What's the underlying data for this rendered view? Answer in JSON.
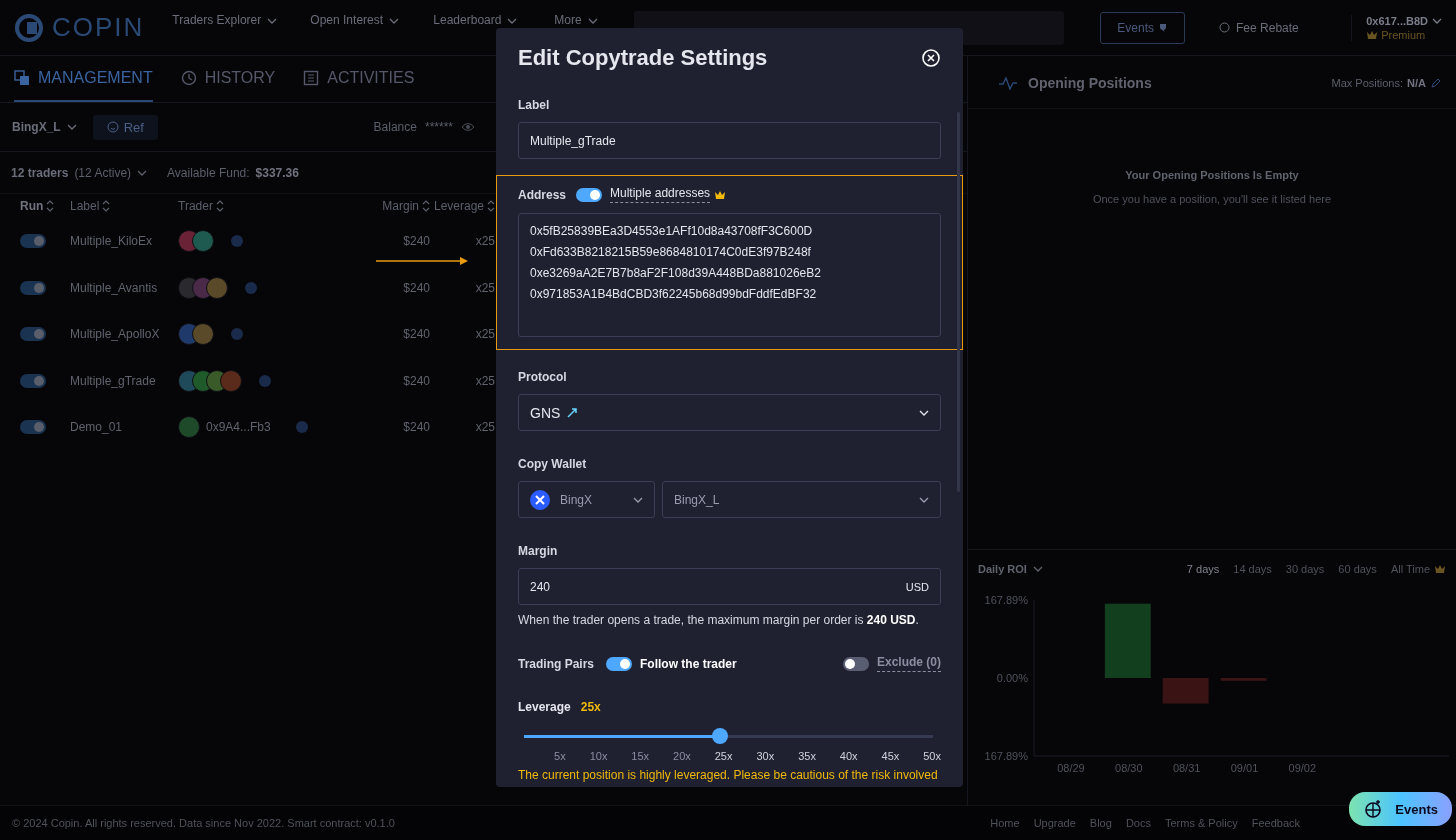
{
  "header": {
    "logo": "COPIN",
    "nav": [
      {
        "label": "Traders Explorer"
      },
      {
        "label": "Open Interest"
      },
      {
        "label": "Leaderboard"
      },
      {
        "label": "More"
      }
    ],
    "events_button": "Events",
    "fee_rebate": "Fee Rebate",
    "account": {
      "address": "0x617...B8D",
      "tier": "Premium"
    }
  },
  "tabs": [
    {
      "label": "MANAGEMENT",
      "selected": true
    },
    {
      "label": "HISTORY",
      "selected": false
    },
    {
      "label": "ACTIVITIES",
      "selected": false
    }
  ],
  "toolbar": {
    "wallet": "BingX_L",
    "ref": "Ref",
    "balance_label": "Balance",
    "balance": "******"
  },
  "summary": {
    "traders": "12 traders",
    "active": "(12 Active)",
    "fund_label": "Available Fund:",
    "fund": "$337.36"
  },
  "table": {
    "columns": [
      "Run",
      "Label",
      "Trader",
      "Margin",
      "Leverage"
    ],
    "rows": [
      {
        "on": true,
        "label": "Multiple_KiloEx",
        "avatars": [
          {
            "color": "#6a2236"
          },
          {
            "color": "#1f5a50"
          }
        ],
        "margin": "$240",
        "leverage": "x25"
      },
      {
        "on": true,
        "label": "Multiple_Avantis",
        "avatars": [
          {
            "color": "#2a2a2e"
          },
          {
            "color": "#4a2a48"
          },
          {
            "color": "#5a4a2a"
          }
        ],
        "margin": "$240",
        "leverage": "x25"
      },
      {
        "on": true,
        "label": "Multiple_ApolloX",
        "avatars": [
          {
            "color": "#1f3a6a"
          },
          {
            "color": "#5a4a2a"
          }
        ],
        "margin": "$240",
        "leverage": "x25"
      },
      {
        "on": true,
        "label": "Multiple_gTrade",
        "avatars": [
          {
            "color": "#1f4a5a"
          },
          {
            "color": "#1f5a2a"
          },
          {
            "color": "#3a5a2a"
          },
          {
            "color": "#5a2a1a"
          }
        ],
        "margin": "$240",
        "leverage": "x25"
      },
      {
        "on": true,
        "label": "Demo_01",
        "avatars": [
          {
            "color": "#1f4a2a"
          }
        ],
        "address": "0x9A4...Fb3",
        "margin": "$240",
        "leverage": "x25"
      }
    ]
  },
  "positions": {
    "title": "Opening Positions",
    "max_label": "Max Positions:",
    "max_value": "N/A",
    "empty_title": "Your Opening Positions Is Empty",
    "empty_text": "Once you have a position, you'll see it listed here"
  },
  "roi": {
    "metric": "Daily ROI",
    "ranges": [
      {
        "label": "7 days",
        "selected": true
      },
      {
        "label": "14 days",
        "selected": false
      },
      {
        "label": "30 days",
        "selected": false
      },
      {
        "label": "60 days",
        "selected": false
      },
      {
        "label": "All Time",
        "selected": false
      }
    ],
    "chart_data": {
      "type": "bar",
      "categories": [
        "08/29",
        "08/30",
        "08/31",
        "09/01",
        "09/02"
      ],
      "series": [
        {
          "color": "#12401e",
          "values": [
            null,
            160,
            null,
            null,
            null
          ]
        },
        {
          "color": "#3a1414",
          "values": [
            null,
            null,
            -55,
            -6,
            null
          ]
        }
      ],
      "ylim": [
        -167.89,
        167.89
      ],
      "yticks": [
        {
          "value": 167.89,
          "label": "167.89%"
        },
        {
          "value": 0,
          "label": "0.00%"
        },
        {
          "value": -167.89,
          "label": "167.89%"
        }
      ]
    }
  },
  "footer": {
    "copyright": "© 2024 Copin. All rights reserved. Data since Nov 2022. Smart contract: v0.1.0",
    "links": [
      "Home",
      "Upgrade",
      "Blog",
      "Docs",
      "Terms & Policy",
      "Feedback"
    ]
  },
  "events_fab": "Events",
  "modal": {
    "title": "Edit Copytrade Settings",
    "label": {
      "label": "Label",
      "value": "Multiple_gTrade"
    },
    "address": {
      "label": "Address",
      "highlighted": true,
      "multiple_on": true,
      "multiple_label": "Multiple addresses",
      "values": [
        "0x5fB25839BEa3D4553e1AFf10d8a43708fF3C600D",
        "0xFd633B8218215B59e8684810174C0dE3f97B248f",
        "0xe3269aA2E7B7b8aF2F108d39A448BDa881026eB2",
        "0x971853A1B4BdCBD3f62245b68d99bdFddfEdBF32"
      ]
    },
    "protocol": {
      "label": "Protocol",
      "value": "GNS"
    },
    "copy_wallet": {
      "label": "Copy Wallet",
      "exchange": "BingX",
      "wallet": "BingX_L"
    },
    "margin": {
      "label": "Margin",
      "value": "240",
      "unit": "USD",
      "hint": "When the trader opens a trade, the maximum margin per order is **240 USD**."
    },
    "trading_pairs": {
      "label": "Trading Pairs",
      "follow_on": true,
      "follow_label": "Follow the trader",
      "exclude_on": false,
      "exclude_label": "Exclude (0)"
    },
    "leverage": {
      "label": "Leverage",
      "value": "25x",
      "level": 0.478,
      "ticks": [
        "5x",
        "10x",
        "15x",
        "20x",
        "25x",
        "30x",
        "35x",
        "40x",
        "45x",
        "50x"
      ],
      "warning": "The current position is highly leveraged. Please be cautious of the risk involved"
    }
  }
}
